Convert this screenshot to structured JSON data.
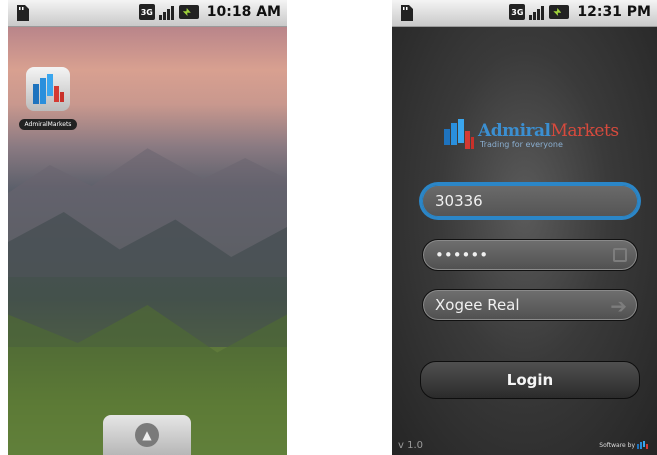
{
  "left_screen": {
    "status": {
      "time": "10:18 AM"
    },
    "app": {
      "label": "AdmiralMarkets"
    }
  },
  "right_screen": {
    "status": {
      "time": "12:31 PM"
    },
    "logo": {
      "brand_part1": "Admiral",
      "brand_part2": "Markets",
      "tagline": "Trading for everyone"
    },
    "login_field": {
      "value": "30336"
    },
    "password_field": {
      "value": "••••••"
    },
    "server_select": {
      "value": "Xogee Real"
    },
    "login_button": {
      "label": "Login"
    },
    "footer": {
      "version": "v 1.0",
      "software_by": "Software by"
    }
  },
  "colors": {
    "accent_blue": "#2b86c7",
    "brand_red": "#d74a3d",
    "brand_blue": "#3b8fd1"
  }
}
